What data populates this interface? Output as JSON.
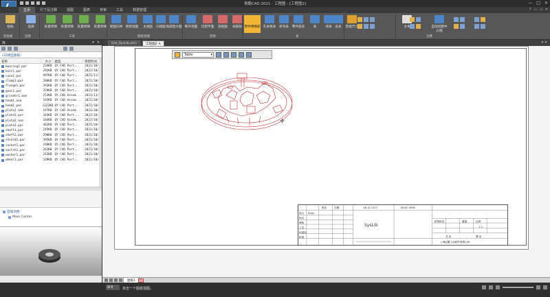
{
  "window": {
    "title": "青鹏CAD 2021 - 工程图 - [工程图2]"
  },
  "menu": {
    "tabs": [
      "主页",
      "尺寸及注释",
      "视图",
      "图表",
      "校审",
      "工具",
      "数据管理"
    ],
    "active": 0
  },
  "ribbon": {
    "buttons": [
      {
        "label": "粘贴",
        "color": "#d9b45a"
      },
      {
        "label": "选择",
        "color": "#8db1e6"
      },
      {
        "label": "批量转换",
        "color": "#6fae4f"
      },
      {
        "label": "批量转换",
        "color": "#6fae4f"
      },
      {
        "label": "批量转换",
        "color": "#6fae4f"
      },
      {
        "label": "批量转换",
        "color": "#6fae4f"
      },
      {
        "label": "视图向导",
        "color": "#4f86c9"
      },
      {
        "label": "更新视图",
        "color": "#4f86c9"
      },
      {
        "label": "主视图",
        "color": "#4f86c9"
      },
      {
        "label": "向视图",
        "color": "#4f86c9"
      },
      {
        "label": "局部放大图",
        "color": "#4f86c9"
      },
      {
        "label": "断开视图",
        "color": "#4f86c9"
      },
      {
        "label": "切割平面",
        "color": "#d46a6a"
      },
      {
        "label": "剖视图",
        "color": "#d46a6a"
      },
      {
        "label": "局部剖",
        "color": "#d46a6a"
      },
      {
        "label": "零件明细表",
        "color": "#f2b636"
      },
      {
        "label": "孔表格表",
        "color": "#4f86c9"
      },
      {
        "label": "折弯表",
        "color": "#4f86c9"
      },
      {
        "label": "零件族表",
        "color": "#4f86c9"
      },
      {
        "label": "表",
        "color": "#4f86c9"
      },
      {
        "label": "块表",
        "color": "#4f86c9"
      },
      {
        "label": "总表",
        "color": "#4f86c9"
      },
      {
        "label": "智能尺寸",
        "color": "#e0a030"
      },
      {
        "label": "文本",
        "color": "#dddddd"
      },
      {
        "label": "自动创建中心线",
        "color": "#4f86c9"
      }
    ],
    "groups": [
      "剪贴板",
      "选择",
      "工具",
      "图纸视图",
      "剖视",
      "表",
      "注释"
    ]
  },
  "leftpanel": {
    "title": "库",
    "search_label": "(3D模型数据)",
    "columns": [
      "名称",
      "大小",
      "类型",
      "修改时间"
    ],
    "files": [
      [
        "bearing1.par",
        "234KB",
        "QY CAD Part...",
        "2021/10/"
      ],
      [
        "bolt1.par",
        "292KB",
        "QY CAD Part...",
        "2021/10/"
      ],
      [
        "case1.par",
        "997KB",
        "QY CAD Part...",
        "2021/11/"
      ],
      [
        "clamp1.par",
        "280KB",
        "QY CAD Part...",
        "2021/10/"
      ],
      [
        "flange1.par",
        "393KB",
        "QY CAD Part...",
        "2021/10/"
      ],
      [
        "gear1.par",
        "359KB",
        "QY CAD Part...",
        "2021/10/"
      ],
      [
        "grinder1.asm",
        "253KB",
        "QY CAD Assem...",
        "2021/11/"
      ],
      [
        "head1.asm",
        "192KB",
        "QY CAD Assem...",
        "2021/10/"
      ],
      [
        "head1.par",
        "1122KB",
        "QY CAD Part...",
        "2021/10/"
      ],
      [
        "plate1.asm",
        "197KB",
        "QY CAD Assem...",
        "2021/10/"
      ],
      [
        "plate1.par",
        "345KB",
        "QY CAD Part...",
        "2021/10/"
      ],
      [
        "plate2.asm",
        "184KB",
        "QY CAD Assem...",
        "2021/10/"
      ],
      [
        "plate2.par",
        "462KB",
        "QY CAD Part...",
        "2021/10/"
      ],
      [
        "shaft1.par",
        "245KB",
        "QY CAD Part...",
        "2021/10/"
      ],
      [
        "shaft2.par",
        "290KB",
        "QY CAD Part...",
        "2021/10/"
      ],
      [
        "shield1.par",
        "395KB",
        "QY CAD Part...",
        "2021/10/"
      ],
      [
        "socket1.par",
        "240KB",
        "QY CAD Part...",
        "2021/10/"
      ],
      [
        "switch1.par",
        "261KB",
        "QY CAD Part...",
        "2021/10/"
      ],
      [
        "washer1.par",
        "243KB",
        "QY CAD Part...",
        "2021/10/"
      ],
      [
        "wheel1.par",
        "339KB",
        "QY CAD Part...",
        "2021/10/"
      ]
    ],
    "tree": [
      "自动文档",
      "Mass Center"
    ]
  },
  "doc": {
    "tabs": [
      "Use_SysLib.asm",
      "工程图2"
    ],
    "active": 1,
    "float_select": "Table",
    "sheet_tab": "图纸1"
  },
  "titleblock": {
    "center": "SysLib",
    "code1": "QB-JZ-1D12",
    "code2": "QB-BC-5836",
    "designer": "Bdlje",
    "labels": [
      "设计",
      "校对",
      "审核",
      "工艺",
      "标准化",
      "批准",
      "签名",
      "日期"
    ],
    "company": "上海企鹏工业软件有限公司",
    "scale_hdr": [
      "阶段标记",
      "重量",
      "比例"
    ],
    "scale": "1:1",
    "sheets": [
      "共 页",
      "第 页"
    ]
  },
  "status": {
    "cmd_label": "命令",
    "message": "单击一个图纸视图。"
  }
}
